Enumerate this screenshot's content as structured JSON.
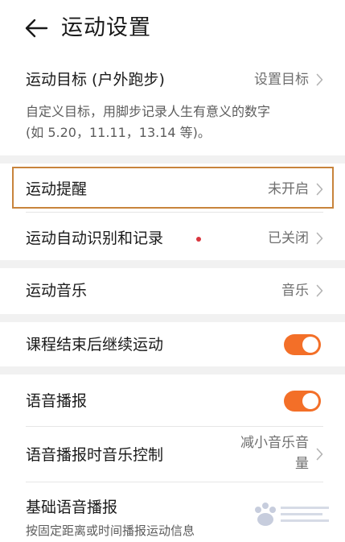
{
  "header": {
    "title": "运动设置"
  },
  "goal": {
    "label": "运动目标 (户外跑步)",
    "value": "设置目标",
    "desc_line1": "自定义目标，用脚步记录人生有意义的数字",
    "desc_line2": "(如 5.20，11.11，13.14 等)。"
  },
  "reminder": {
    "label": "运动提醒",
    "value": "未开启"
  },
  "auto_detect": {
    "label": "运动自动识别和记录",
    "value": "已关闭"
  },
  "music": {
    "label": "运动音乐",
    "value": "音乐"
  },
  "continue_after_course": {
    "label": "课程结束后继续运动",
    "enabled": true
  },
  "voice_broadcast": {
    "label": "语音播报",
    "enabled": true
  },
  "voice_music_control": {
    "label": "语音播报时音乐控制",
    "value_line1": "减小音乐音",
    "value_line2": "量"
  },
  "basic_voice": {
    "label": "基础语音播报",
    "desc": "按固定距离或时间播报运动信息"
  },
  "colors": {
    "accent_toggle": "#f36f28",
    "highlight_border": "#c8843c",
    "red_dot": "#d9363e"
  },
  "icons": {
    "back": "arrow-left-icon",
    "chevron": "chevron-right-icon"
  }
}
